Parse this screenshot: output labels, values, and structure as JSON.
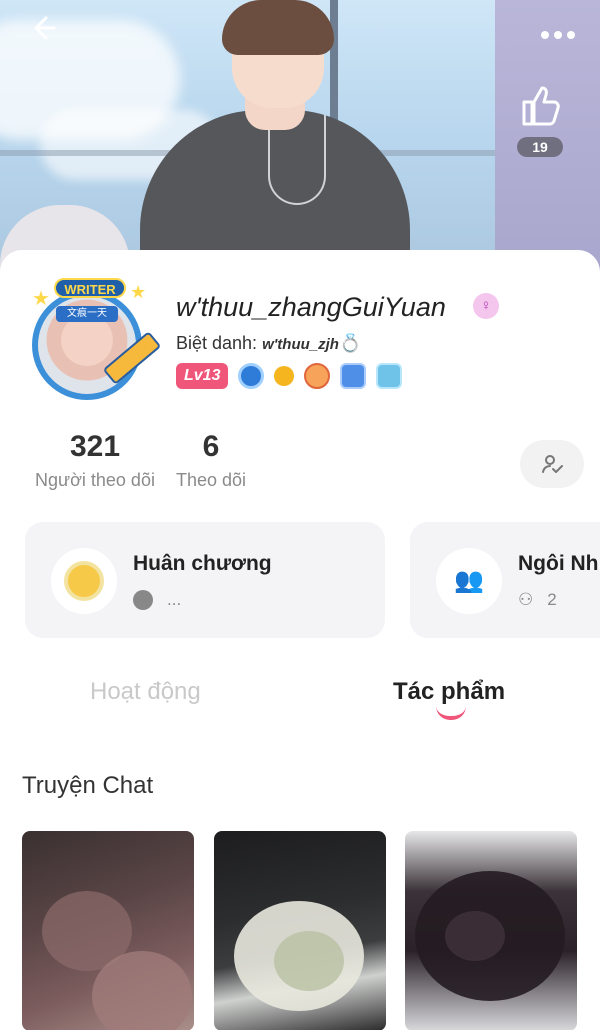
{
  "header": {
    "back_icon": "arrow-left-icon",
    "more_icon": "more-dots-icon",
    "like_icon": "thumbs-up-icon",
    "like_count": "19"
  },
  "profile": {
    "avatar_badge": "WRITER",
    "avatar_tag": "文痕一天",
    "username": "w'thuu_zhangGuiYuan",
    "gender_symbol": "♀",
    "nickname_label": "Biệt danh: ",
    "nickname_value": "w'thuu_zjh",
    "ring_symbol": "💍",
    "level": "Lv13"
  },
  "stats": {
    "followers_count": "321",
    "followers_label": "Người theo dõi",
    "following_count": "6",
    "following_label": "Theo dõi"
  },
  "cards": {
    "medals": {
      "title": "Huân chương",
      "sub": "..."
    },
    "house": {
      "title": "Ngôi Nh",
      "sub": "2"
    }
  },
  "tabs": {
    "activity": "Hoạt động",
    "works": "Tác phẩm"
  },
  "section": {
    "title": "Truyện Chat"
  },
  "colors": {
    "accent": "#f0567a",
    "level_badge": "#f0567a",
    "tab_active": "#222222",
    "tab_inactive": "#c9c9c9"
  }
}
